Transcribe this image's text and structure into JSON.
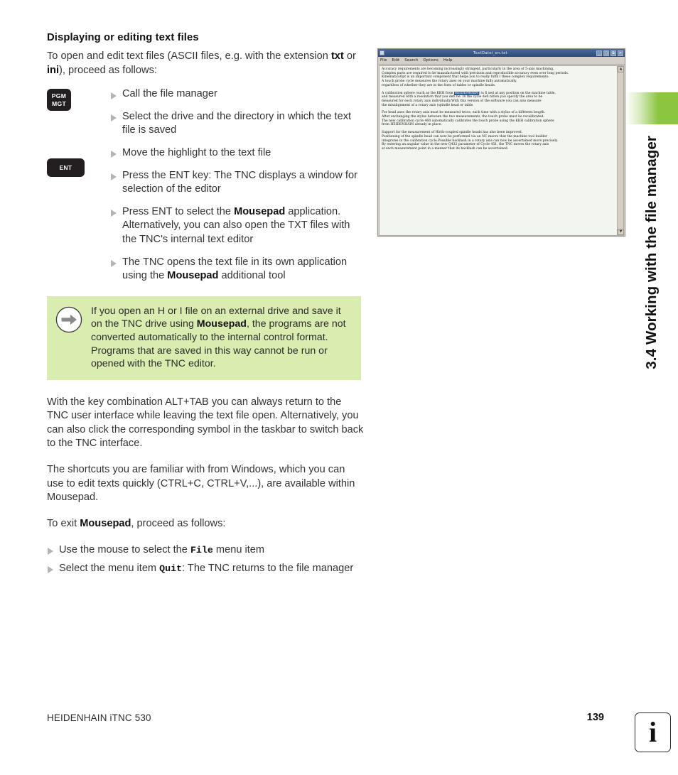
{
  "side_tab": {
    "title": "3.4 Working with the file manager",
    "band_color": "#8cc540"
  },
  "content": {
    "heading": "Displaying or editing text files",
    "intro_html_1": "To open and edit text files (ASCII files, e.g. with the extension ",
    "intro_bold_1": "txt",
    "intro_html_2": " or ",
    "intro_bold_2": "ini",
    "intro_html_3": "), proceed as follows:",
    "keys": [
      {
        "name": "pgm-mgt-key",
        "line1": "PGM",
        "line2": "MGT"
      },
      {
        "name": "ent-key",
        "line1": "ENT",
        "line2": ""
      }
    ],
    "steps": [
      {
        "text": "Call the file manager"
      },
      {
        "text": "Select the drive and the directory in which the text file is saved"
      },
      {
        "text": "Move the highlight to the text file"
      },
      {
        "text": "Press the ENT key: The TNC displays a window for selection of the editor"
      },
      {
        "pre": "Press ENT to select the ",
        "bold": "Mousepad",
        "post": " application. Alternatively, you can also open the TXT files with the TNC's internal text editor"
      },
      {
        "pre": "The TNC opens the text file in its own application using the ",
        "bold": "Mousepad",
        "post": " additional tool"
      }
    ],
    "note": {
      "icon": "arrow-right-icon",
      "pre": "If you open an H or I file on an external drive and save it on the TNC drive using ",
      "bold": "Mousepad",
      "post": ", the programs are not converted automatically to the internal control format. Programs that are saved in this way cannot be run or opened with the TNC editor.",
      "background": "#d9edb0"
    },
    "tail_paragraphs": [
      "With the key combination ALT+TAB you can always return to the TNC user interface while leaving the text file open. Alternatively, you can also click the corresponding symbol in the taskbar to switch back to the TNC interface.",
      "The shortcuts you are familiar with from Windows, which you can use to edit texts quickly (CTRL+C, CTRL+V,...), are available within Mousepad."
    ],
    "exit_line": {
      "pre": "To exit ",
      "bold": "Mousepad",
      "post": ", proceed as follows:"
    },
    "tail_steps": [
      {
        "pre": "Use the mouse to select the ",
        "mono": "File",
        "post": " menu item"
      },
      {
        "pre": "Select the menu item ",
        "mono": "Quit",
        "post": ": The TNC returns to the file manager"
      }
    ]
  },
  "figure": {
    "title": "TextDatei_en.txt",
    "app_icon": "application-icon",
    "window_buttons": [
      "minimize",
      "maximize",
      "restore",
      "close"
    ],
    "menu": [
      "File",
      "Edit",
      "Search",
      "Options",
      "Help"
    ],
    "scroll_up": "▲",
    "scroll_down": "▼",
    "paragraphs": [
      {
        "lines": [
          "Accuracy requirements are becoming increasingly stringent, particularly in the area of 5-axis machining.",
          "Complex parts are required to be manufactured with precision and reproducible accuracy even over long periods.",
          "KinematicsOpt is an important component that helps you to really fulfil l these complex requirements:",
          "A touch probe cycle measures the rotary axes on your machine fully automatically,",
          "regardless of whether they are in the form of tables or spindle heads."
        ]
      },
      {
        "selection": "HEIDENHAIN",
        "line_pre": "A calibration sphere (such as the KKH from ",
        "line_post": ") is fi xed at any position on the machine table,",
        "lines": [
          "and measured with a resolution that you defi ne. In the cycle defi nition you specify the area to be",
          "measured for each rotary axis individually.With this version of the software you can also measure",
          "the misalignment of a rotary axis (spindle head or table."
        ]
      },
      {
        "lines": [
          "For head axes the rotary axis must be measured twice, each time with a stylus of a different length.",
          "After exchanging the stylus between the two measurements, the touch probe must be recalibrated.",
          "The new calibration cycle 460 automatically calibrates the touch probe using the KKH calibration sphere",
          "from HEIDENHAIN already in place."
        ]
      },
      {
        "lines": [
          "Support for the measurement of Hirth-coupled spindle heads has also been improved.",
          "Positioning of the spindle head can now be performed via an NC macro that the machine tool builder",
          "integrates in the calibration cycle.Possible backlash in a rotary axis can now be ascertained more precisely.",
          "By entering an angular value in the new Q432 parameter of Cycle 451, the TNC moves the rotary axis",
          "at each measurement point in a manner that its backlash can be ascertained."
        ]
      }
    ]
  },
  "footer": {
    "brand": "HEIDENHAIN iTNC 530",
    "page_number": "139",
    "info_icon_glyph": "i",
    "info_icon_name": "info-icon"
  }
}
